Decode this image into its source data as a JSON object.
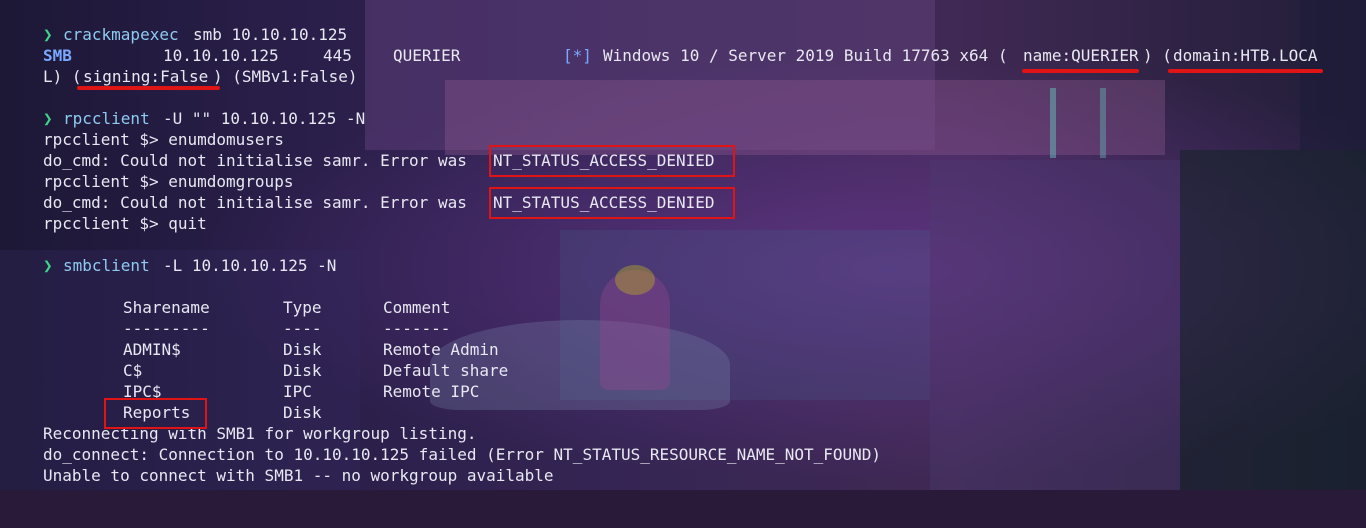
{
  "background": {
    "icon": "neon-city-wallpaper"
  },
  "colors": {
    "prompt_arrow": "#3fd48a",
    "command": "#8ecbf2",
    "smb_tag": "#7aa8ff",
    "highlight": "#e01414",
    "text": "#e8e8f2"
  },
  "lines": {
    "cme": {
      "arrow": "❯",
      "command": "crackmapexec",
      "args": "smb 10.10.10.125"
    },
    "smb_out": {
      "tag": "SMB",
      "ip": "10.10.10.125",
      "port": "445",
      "host": "QUERIER",
      "star": "[*]",
      "os": "Windows 10 / Server 2019 Build 17763 x64 (",
      "name": "name:QUERIER",
      "mid": ") (",
      "domain": "domain:HTB.LOCA"
    },
    "smb_out2": {
      "pre": "L) (",
      "signing": "signing:False",
      "post": ") (SMBv1:False)"
    },
    "rpc": {
      "arrow": "❯",
      "command": "rpcclient",
      "args": "-U \"\" 10.10.10.125 -N"
    },
    "rpc1": "rpcclient $> enumdomusers",
    "rpc2": {
      "text": "do_cmd: Could not initialise samr. Error was ",
      "error": "NT_STATUS_ACCESS_DENIED"
    },
    "rpc3": "rpcclient $> enumdomgroups",
    "rpc4": {
      "text": "do_cmd: Could not initialise samr. Error was ",
      "error": "NT_STATUS_ACCESS_DENIED"
    },
    "rpc5": "rpcclient $> quit",
    "smbc": {
      "arrow": "❯",
      "command": "smbclient",
      "args": "-L 10.10.10.125 -N"
    },
    "shares_header": {
      "name": "Sharename",
      "type": "Type",
      "comment": "Comment"
    },
    "shares_sep": {
      "name": "---------",
      "type": "----",
      "comment": "-------"
    },
    "shares": [
      {
        "name": "ADMIN$",
        "type": "Disk",
        "comment": "Remote Admin"
      },
      {
        "name": "C$",
        "type": "Disk",
        "comment": "Default share"
      },
      {
        "name": "IPC$",
        "type": "IPC",
        "comment": "Remote IPC"
      },
      {
        "name": "Reports",
        "type": "Disk",
        "comment": ""
      }
    ],
    "tail1": "Reconnecting with SMB1 for workgroup listing.",
    "tail2": "do_connect: Connection to 10.10.10.125 failed (Error NT_STATUS_RESOURCE_NAME_NOT_FOUND)",
    "tail3": "Unable to connect with SMB1 -- no workgroup available"
  }
}
